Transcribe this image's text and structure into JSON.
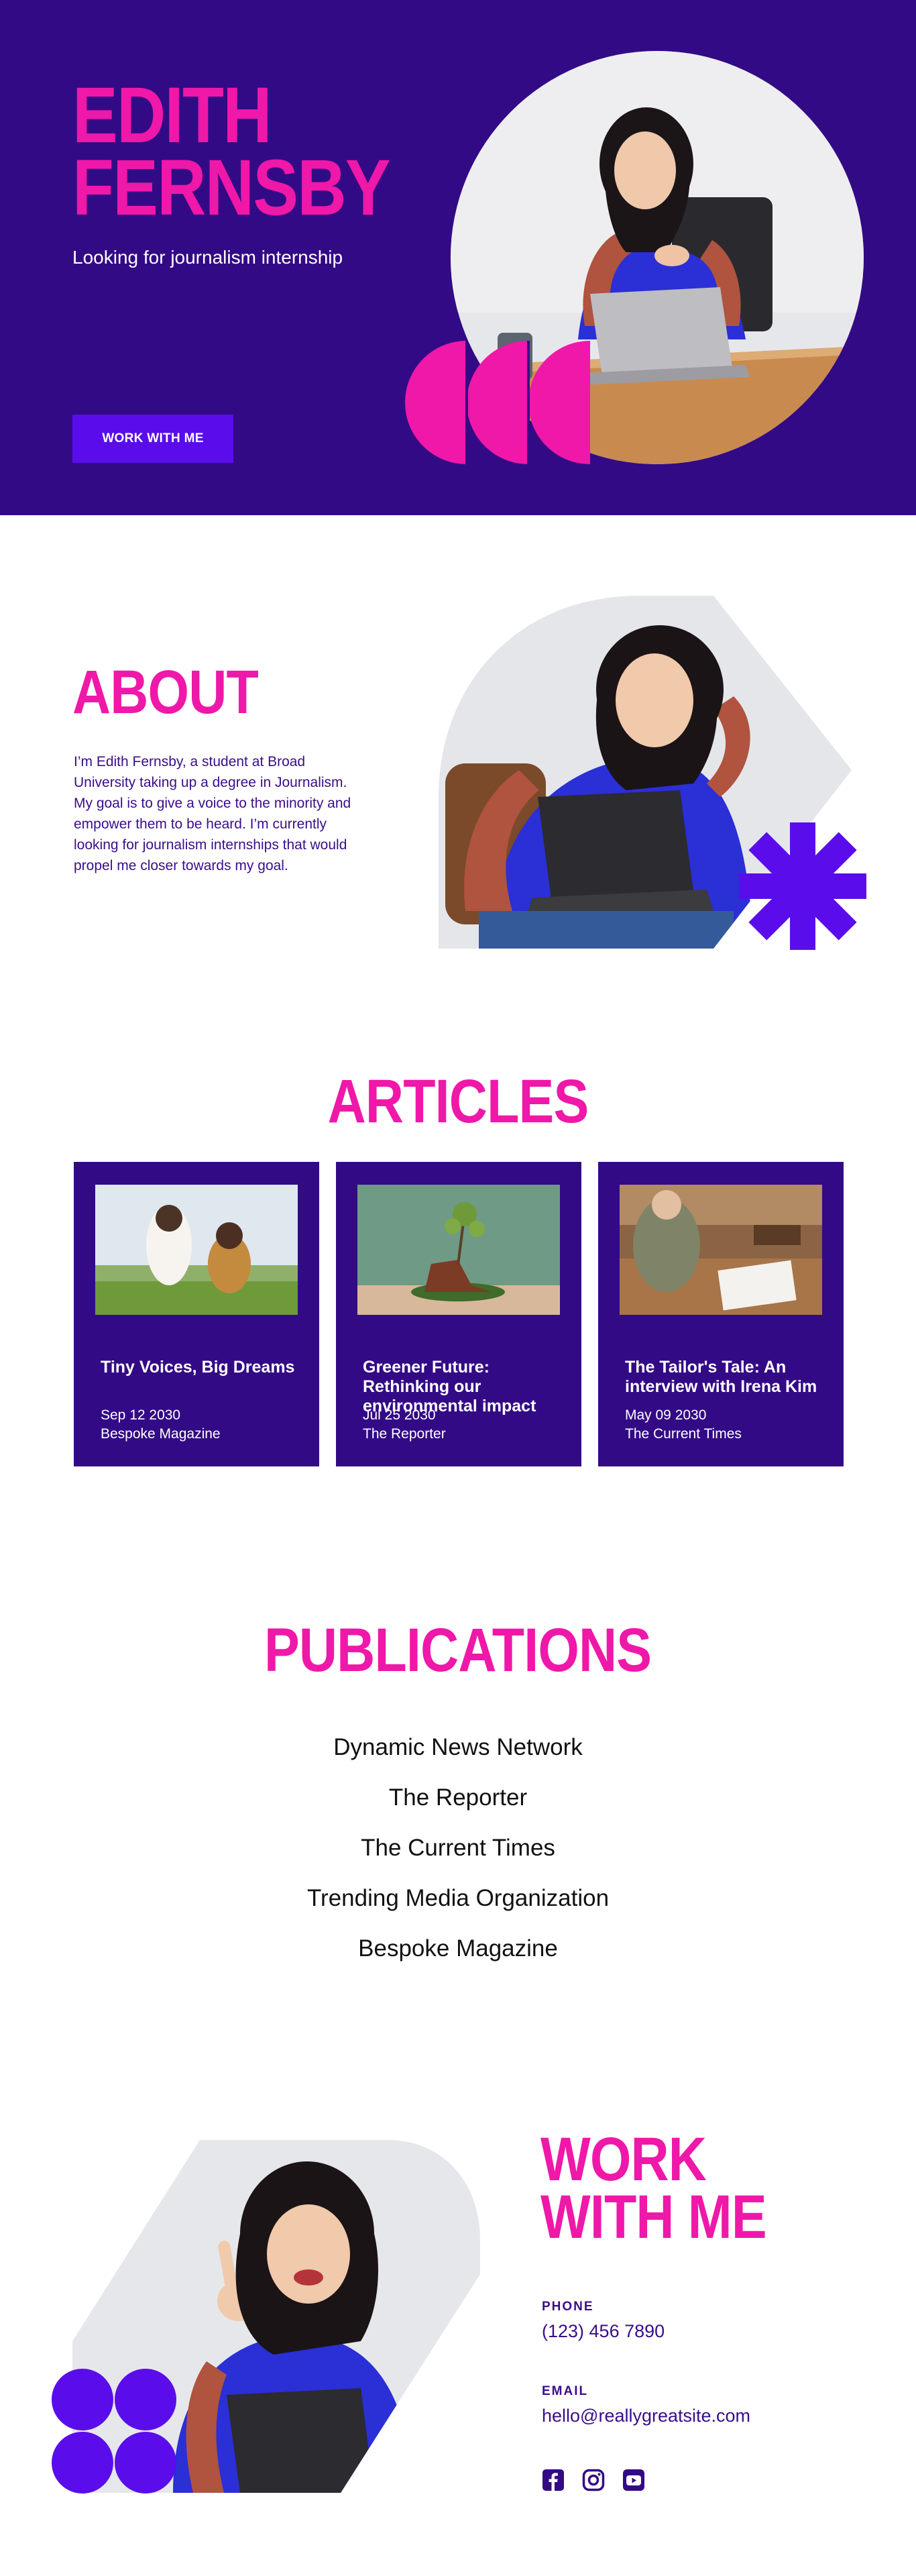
{
  "hero": {
    "name_line1": "EDITH",
    "name_line2": "FERNSBY",
    "subtitle": "Looking for journalism internship",
    "cta_label": "WORK WITH ME"
  },
  "about": {
    "title": "ABOUT",
    "text": "I’m Edith Fernsby, a student at Broad University taking up a degree in Journalism. My goal is to give a voice to the minority and empower them to be heard. I’m currently looking for journalism internships that would propel me closer towards my goal."
  },
  "articles": {
    "title": "ARTICLES",
    "items": [
      {
        "title": "Tiny Voices, Big Dreams",
        "date": "Sep 12 2030",
        "publication": "Bespoke Magazine"
      },
      {
        "title": "Greener Future: Rethinking our environmental impact",
        "date": "Jul 25 2030",
        "publication": "The Reporter"
      },
      {
        "title": "The Tailor's Tale: An interview with Irena Kim",
        "date": "May 09 2030",
        "publication": "The Current Times"
      }
    ]
  },
  "publications": {
    "title": "PUBLICATIONS",
    "items": [
      "Dynamic News Network",
      "The Reporter",
      "The Current Times",
      "Trending Media Organization",
      "Bespoke Magazine"
    ]
  },
  "contact": {
    "title_line1": "WORK",
    "title_line2": "WITH ME",
    "phone_label": "PHONE",
    "phone": "(123) 456 7890",
    "email_label": "EMAIL",
    "email": "hello@reallygreatsite.com",
    "socials": [
      "facebook-icon",
      "instagram-icon",
      "youtube-icon"
    ]
  },
  "colors": {
    "brand_purple": "#330a85",
    "accent_pink": "#ef18a9",
    "accent_violet": "#5a0dea"
  }
}
